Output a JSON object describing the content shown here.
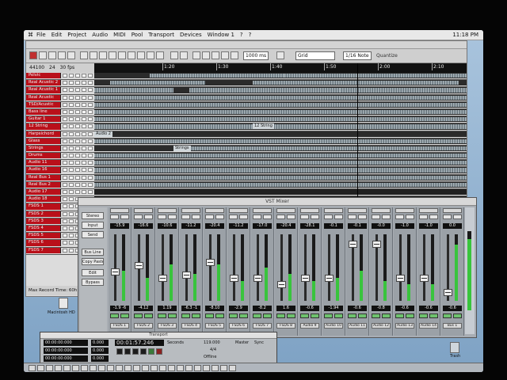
{
  "menubar": {
    "apple": "⌘",
    "menus": [
      "File",
      "Edit",
      "Project",
      "Audio",
      "MIDI",
      "Pool",
      "Transport",
      "Devices",
      "Window 1",
      "?",
      "?"
    ],
    "clock": "11:18 PM"
  },
  "project_window": {
    "title": "",
    "toolbar": {
      "zoom_value": "1000 ms",
      "grid_label": "Grid",
      "quantize_value": "1/16 Note",
      "snap_label": "Quantize"
    },
    "info": {
      "rate": "44100",
      "bits": "24",
      "fps": "30 fps"
    },
    "ruler_ticks": [
      "1:20",
      "1:30",
      "1:40",
      "1:50",
      "2:00",
      "2:10"
    ],
    "tracks": [
      "Pelvic",
      "Real Acustic 2",
      "Real Acustic 1",
      "Real Acustic",
      "TSD/Acustic",
      "Bass line",
      "Guitar 1",
      "12 String",
      "Harpsichord",
      "Glass",
      "Strings",
      "Drums",
      "Audio 11",
      "Audio 16",
      "Real Bus 1",
      "Real Bus 2",
      "Audio 17",
      "Audio 18",
      "FSDS 1",
      "FSDS 2",
      "FSDS 3",
      "FSDS 4",
      "FSDS 5",
      "FSDS 6",
      "FSDS 7"
    ],
    "part_labels": [
      "Audio 2",
      "12 String",
      "Strings"
    ],
    "status": "Max Record Time: 60h"
  },
  "mixer": {
    "title": "VST Mixer",
    "left_buttons": [
      "Stereo",
      "Input",
      "Send",
      "Bus Line",
      "Copy Paste",
      "Edit",
      "Bypass"
    ],
    "strips": [
      {
        "value": "-15.9",
        "level": 0.45,
        "fader": 0.45,
        "bottom": "-1.9 -6",
        "name": "FSDS 1"
      },
      {
        "value": "-16.6",
        "level": 0.35,
        "fader": 0.55,
        "bottom": "-4.12",
        "name": "FSDS 2"
      },
      {
        "value": "-10.6",
        "level": 0.55,
        "fader": 0.35,
        "bottom": "1.19",
        "name": "FSDS 3"
      },
      {
        "value": "-11.2",
        "level": 0.4,
        "fader": 0.4,
        "bottom": "-6.3 -1",
        "name": "FSDS 4"
      },
      {
        "value": "-20.4",
        "level": 0.55,
        "fader": 0.6,
        "bottom": "-8.10",
        "name": "FSDS 5"
      },
      {
        "value": "-11.2",
        "level": 0.3,
        "fader": 0.35,
        "bottom": "-2.9",
        "name": "FSDS 6"
      },
      {
        "value": "-17.0",
        "level": 0.5,
        "fader": 0.35,
        "bottom": "-8.2",
        "name": "FSDS 7"
      },
      {
        "value": "-20.4",
        "level": 0.4,
        "fader": 0.25,
        "bottom": "1.6",
        "name": "FSDS 8"
      },
      {
        "value": "-28.1",
        "level": 0.3,
        "fader": 0.35,
        "bottom": "-0.6",
        "name": "Audio 9"
      },
      {
        "value": "-0.1",
        "level": 0.35,
        "fader": 0.35,
        "bottom": "-1.94",
        "name": "Audio 10"
      },
      {
        "value": "-0.1",
        "level": 0.45,
        "fader": 0.9,
        "bottom": "-0.6",
        "name": "Audio 11"
      },
      {
        "value": "-0.0",
        "level": 0.3,
        "fader": 0.9,
        "bottom": "-0.8",
        "name": "Audio 12"
      },
      {
        "value": "-1.0",
        "level": 0.25,
        "fader": 0.35,
        "bottom": "-0.6",
        "name": "Audio 13"
      },
      {
        "value": "-1.0",
        "level": 0.25,
        "fader": 0.35,
        "bottom": "-0.6",
        "name": "Audio 14"
      },
      {
        "value": "0.0",
        "level": 0.85,
        "fader": 0.12,
        "bottom": "-0.6",
        "name": "Bus 1"
      }
    ],
    "master_level": 0.9
  },
  "transport": {
    "title": "Transport",
    "left_times": [
      "00:00:00:000",
      "00:00:00:000",
      "00:00:00:000"
    ],
    "left_small": [
      "0.000",
      "0.000",
      "0.000"
    ],
    "position": "00:01:57.246",
    "mode": "Seconds",
    "signature": "4/4",
    "tempo": "119.000",
    "offline": "Offline",
    "sync": "Sync",
    "master": "Master"
  },
  "desktop": {
    "icons": [
      "Macintosh HD",
      "Trash"
    ]
  }
}
